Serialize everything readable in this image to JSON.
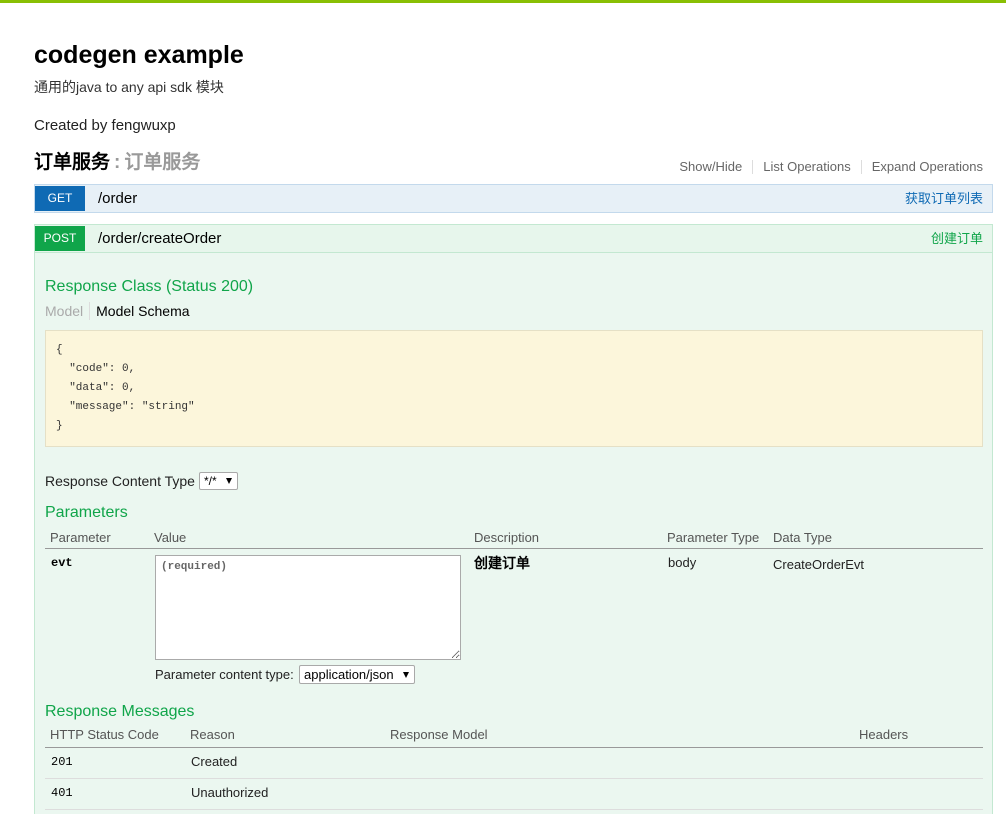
{
  "page": {
    "title": "codegen example",
    "description": "通用的java to any api sdk 模块",
    "created_by": "Created by fengwuxp"
  },
  "resource": {
    "name": "订单服务",
    "separator": ":",
    "description": "订单服务",
    "links": {
      "show_hide": "Show/Hide",
      "list_operations": "List Operations",
      "expand_operations": "Expand Operations"
    }
  },
  "operations": [
    {
      "method": "GET",
      "path": "/order",
      "summary": "获取订单列表"
    },
    {
      "method": "POST",
      "path": "/order/createOrder",
      "summary": "创建订单"
    }
  ],
  "create_order": {
    "response_class_title": "Response Class (Status 200)",
    "model_tabs": {
      "model": "Model",
      "model_schema": "Model Schema"
    },
    "model_schema": "{\n  \"code\": 0,\n  \"data\": 0,\n  \"message\": \"string\"\n}",
    "response_content_type": {
      "label": "Response Content Type",
      "selected": "*/*"
    },
    "parameters_title": "Parameters",
    "parameter_columns": {
      "parameter": "Parameter",
      "value": "Value",
      "description": "Description",
      "parameter_type": "Parameter Type",
      "data_type": "Data Type"
    },
    "parameters": [
      {
        "name": "evt",
        "placeholder": "(required)",
        "description": "创建订单",
        "parameter_type": "body",
        "data_type": "CreateOrderEvt",
        "content_type_label": "Parameter content type:",
        "content_type_selected": "application/json"
      }
    ],
    "response_messages_title": "Response Messages",
    "response_message_columns": {
      "status_code": "HTTP Status Code",
      "reason": "Reason",
      "response_model": "Response Model",
      "headers": "Headers"
    },
    "response_messages": [
      {
        "status_code": "201",
        "reason": "Created"
      },
      {
        "status_code": "401",
        "reason": "Unauthorized"
      }
    ]
  },
  "colors": {
    "header_bar": "#89bf04",
    "get_method": "#0f6ab4",
    "get_background": "#e7f0f7",
    "post_method": "#10a54a",
    "post_background": "#e7f6ec",
    "section_heading": "#10a54a",
    "operation_body_background": "#ebf7f0",
    "schema_background": "#fcf6db"
  },
  "icons": {
    "select_arrow": "chevron-down-icon"
  }
}
